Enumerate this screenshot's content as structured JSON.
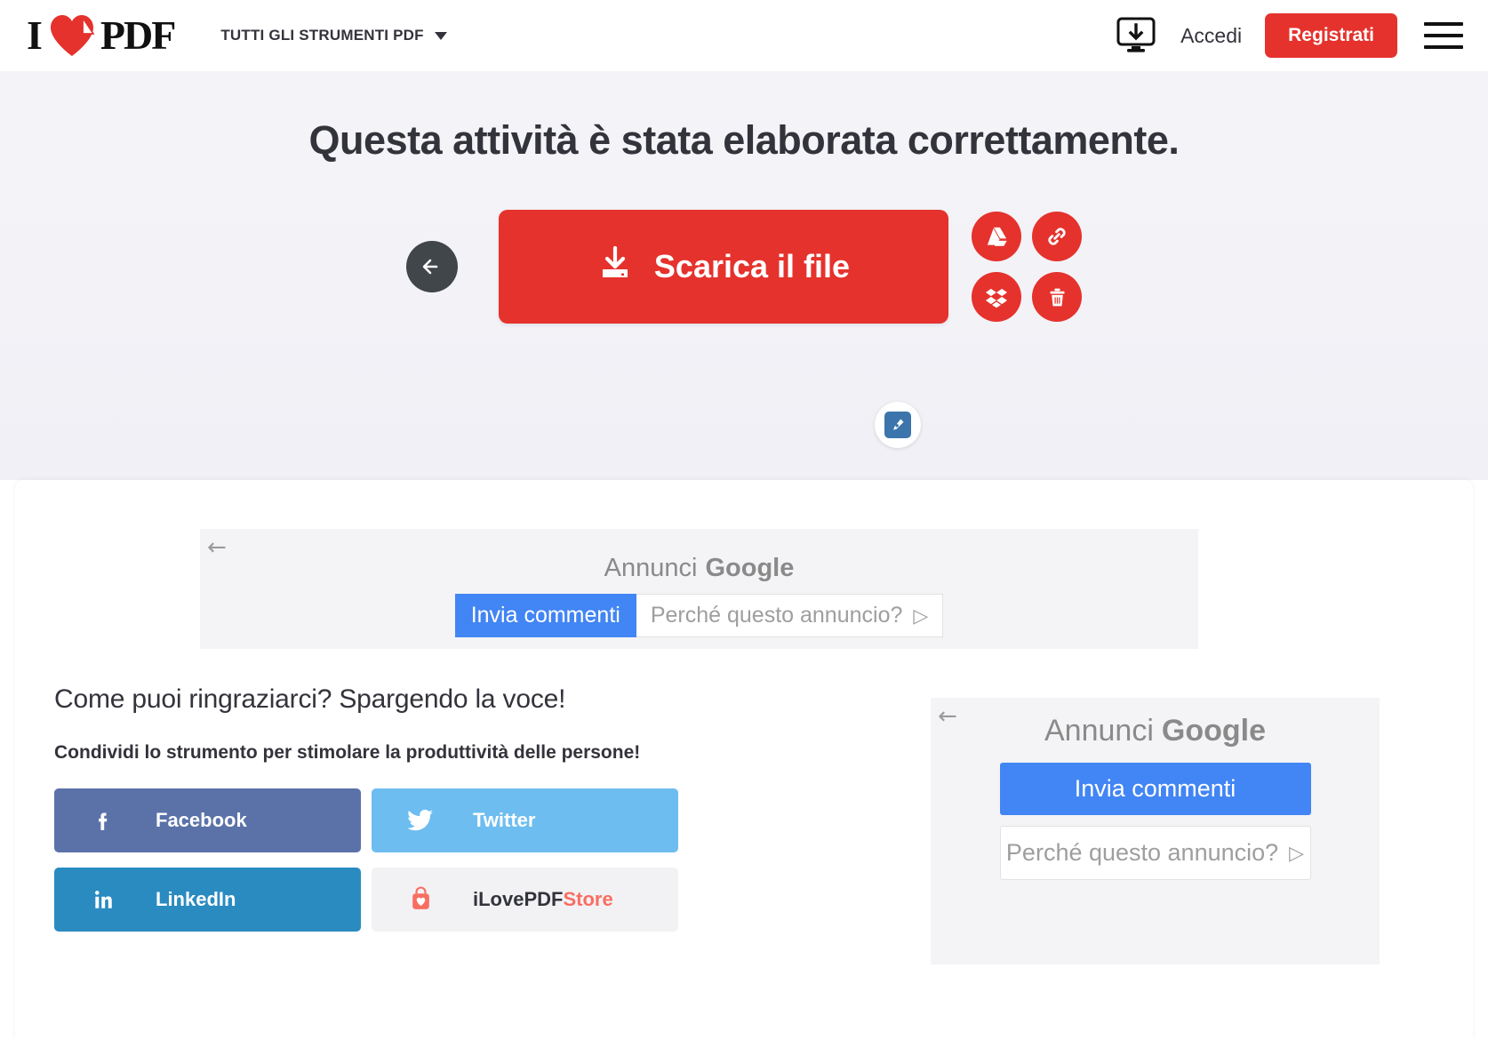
{
  "header": {
    "logo": {
      "i": "I",
      "pdf": "PDF",
      "heart_icon": "heart-page-fold-icon"
    },
    "tools_menu": "TUTTI GLI STRUMENTI PDF",
    "desktop_icon": "desktop-download-icon",
    "login_label": "Accedi",
    "signup_label": "Registrati",
    "menu_icon": "hamburger-menu-icon",
    "accent_color": "#e5322d"
  },
  "hero": {
    "title": "Questa attività è stata elaborata correttamente.",
    "back_icon": "arrow-left-icon",
    "download_label": "Scarica il file",
    "download_icon": "download-icon",
    "cloud_actions": [
      {
        "name": "google-drive",
        "icon": "google-drive-icon"
      },
      {
        "name": "copy-link",
        "icon": "link-chain-icon"
      },
      {
        "name": "dropbox",
        "icon": "dropbox-icon"
      },
      {
        "name": "delete",
        "icon": "trash-icon"
      }
    ],
    "sign_icon": "pen-nib-sign-icon",
    "background_color": "#f1f1f7"
  },
  "ad_top": {
    "back_icon": "arrow-left-icon",
    "label_prefix": "Annunci",
    "label_google": "Google",
    "feedback_label": "Invia commenti",
    "why_label": "Perché questo annuncio?",
    "why_glyph": "▷"
  },
  "ad_right": {
    "back_icon": "arrow-left-icon",
    "label_prefix": "Annunci",
    "label_google": "Google",
    "feedback_label": "Invia commenti",
    "why_label": "Perché questo annuncio?",
    "why_glyph": "▷"
  },
  "share": {
    "title": "Come puoi ringraziarci? Spargendo la voce!",
    "subtitle": "Condividi lo strumento per stimolare la produttività delle persone!",
    "buttons": [
      {
        "label": "Facebook",
        "icon": "facebook-icon",
        "color": "#5b72a9"
      },
      {
        "label": "Twitter",
        "icon": "twitter-bird-icon",
        "color": "#6dbdf0"
      },
      {
        "label": "LinkedIn",
        "icon": "linkedin-icon",
        "color": "#2a8bc0"
      }
    ],
    "store": {
      "label_primary": "iLovePDF",
      "label_secondary": "Store",
      "icon": "shopping-bag-heart-icon"
    }
  }
}
